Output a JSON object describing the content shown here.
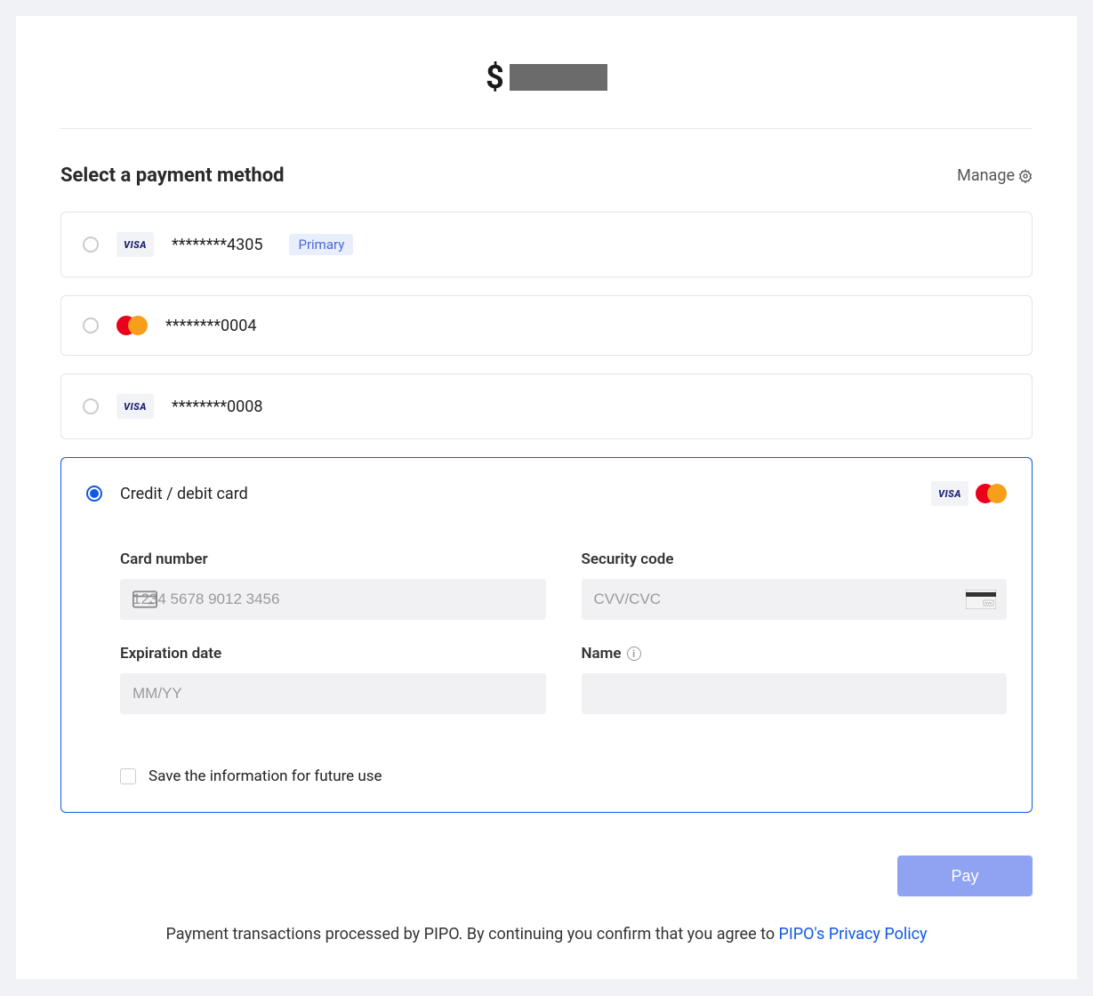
{
  "amount_currency": "$",
  "section_title": "Select a payment method",
  "manage_label": "Manage",
  "payment_methods": [
    {
      "brand": "VISA",
      "masked": "********4305",
      "primary_label": "Primary",
      "selected": false
    },
    {
      "brand": "mastercard",
      "masked": "********0004",
      "selected": false
    },
    {
      "brand": "VISA",
      "masked": "********0008",
      "selected": false
    }
  ],
  "new_card": {
    "label": "Credit / debit card",
    "supported_brands": [
      "VISA",
      "mastercard"
    ],
    "selected": true,
    "fields": {
      "card_number": {
        "label": "Card number",
        "placeholder": "1234 5678 9012 3456",
        "value": ""
      },
      "security_code": {
        "label": "Security code",
        "placeholder": "CVV/CVC",
        "value": ""
      },
      "expiration": {
        "label": "Expiration date",
        "placeholder": "MM/YY",
        "value": ""
      },
      "name": {
        "label": "Name",
        "placeholder": "",
        "value": ""
      }
    },
    "save_label": "Save the information for future use",
    "save_checked": false
  },
  "pay_button": "Pay",
  "disclaimer_prefix": "Payment transactions processed by PIPO. By continuing you confirm that you agree to ",
  "disclaimer_link": "PIPO's Privacy Policy"
}
